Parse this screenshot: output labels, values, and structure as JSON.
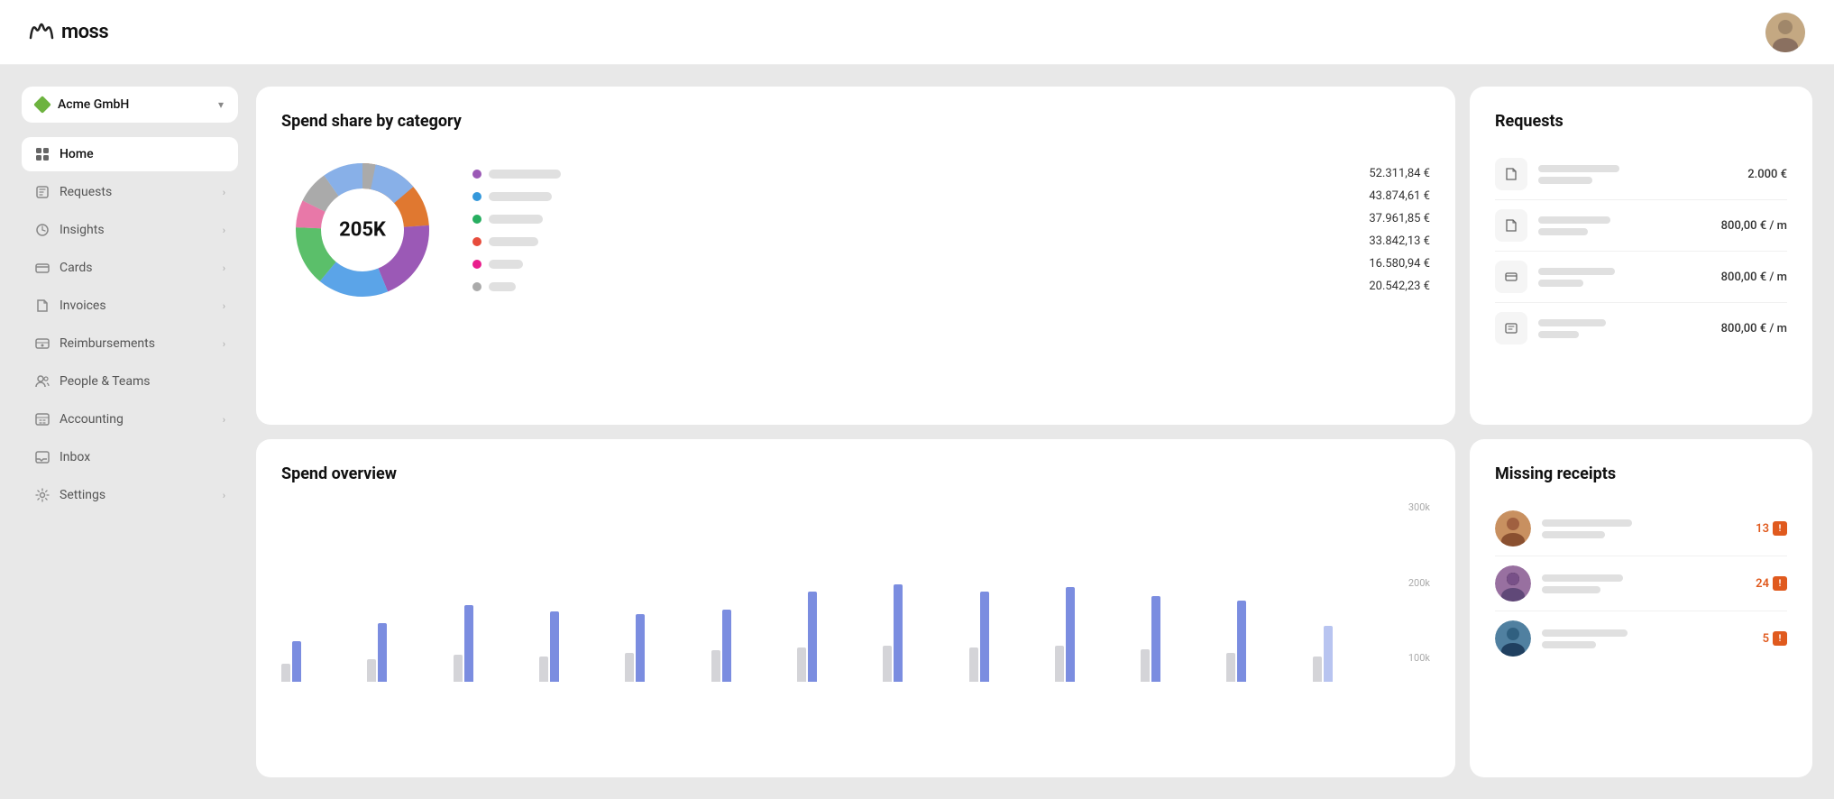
{
  "app": {
    "name": "moss"
  },
  "topnav": {
    "logo": "moss"
  },
  "sidebar": {
    "company": {
      "name": "Acme GmbH"
    },
    "items": [
      {
        "id": "home",
        "label": "Home",
        "icon": "home",
        "active": true,
        "hasChevron": false
      },
      {
        "id": "requests",
        "label": "Requests",
        "icon": "requests",
        "active": false,
        "hasChevron": true
      },
      {
        "id": "insights",
        "label": "Insights",
        "icon": "insights",
        "active": false,
        "hasChevron": true
      },
      {
        "id": "cards",
        "label": "Cards",
        "icon": "cards",
        "active": false,
        "hasChevron": true
      },
      {
        "id": "invoices",
        "label": "Invoices",
        "icon": "invoices",
        "active": false,
        "hasChevron": true
      },
      {
        "id": "reimbursements",
        "label": "Reimbursements",
        "icon": "reimbursements",
        "active": false,
        "hasChevron": true
      },
      {
        "id": "people-teams",
        "label": "People & Teams",
        "icon": "people",
        "active": false,
        "hasChevron": false
      },
      {
        "id": "accounting",
        "label": "Accounting",
        "icon": "accounting",
        "active": false,
        "hasChevron": true
      },
      {
        "id": "inbox",
        "label": "Inbox",
        "icon": "inbox",
        "active": false,
        "hasChevron": false
      },
      {
        "id": "settings",
        "label": "Settings",
        "icon": "settings",
        "active": false,
        "hasChevron": true
      }
    ]
  },
  "spend_share": {
    "title": "Spend share by category",
    "total": "205K",
    "legend": [
      {
        "color": "#9b59b6",
        "value": "52.311,84 €"
      },
      {
        "color": "#3498db",
        "value": "43.874,61 €"
      },
      {
        "color": "#27ae60",
        "value": "37.961,85 €"
      },
      {
        "color": "#e74c3c",
        "value": "33.842,13 €"
      },
      {
        "color": "#e91e8c",
        "value": "16.580,94 €"
      },
      {
        "color": "#aaaaaa",
        "value": "20.542,23 €"
      }
    ]
  },
  "requests": {
    "title": "Requests",
    "items": [
      {
        "icon": "doc",
        "amount": "2.000 €"
      },
      {
        "icon": "doc",
        "amount": "800,00 € / m"
      },
      {
        "icon": "card",
        "amount": "800,00 € / m"
      },
      {
        "icon": "calendar",
        "amount": "800,00 € / m"
      }
    ]
  },
  "spend_overview": {
    "title": "Spend overview",
    "y_axis": [
      "300k",
      "200k",
      "100k"
    ],
    "bars": [
      {
        "gray": 30,
        "blue": 45
      },
      {
        "gray": 35,
        "blue": 60
      },
      {
        "gray": 40,
        "blue": 80
      },
      {
        "gray": 38,
        "blue": 75
      },
      {
        "gray": 42,
        "blue": 72
      },
      {
        "gray": 45,
        "blue": 78
      },
      {
        "gray": 50,
        "blue": 95
      },
      {
        "gray": 55,
        "blue": 100
      },
      {
        "gray": 52,
        "blue": 95
      },
      {
        "gray": 55,
        "blue": 100
      },
      {
        "gray": 50,
        "blue": 90
      },
      {
        "gray": 45,
        "blue": 88
      },
      {
        "gray": 40,
        "blue": 60
      }
    ]
  },
  "missing_receipts": {
    "title": "Missing receipts",
    "items": [
      {
        "count": "13",
        "avatar_color": "#c87941"
      },
      {
        "count": "24",
        "avatar_color": "#8b4a6e"
      },
      {
        "count": "5",
        "avatar_color": "#3a6e8b"
      }
    ]
  }
}
